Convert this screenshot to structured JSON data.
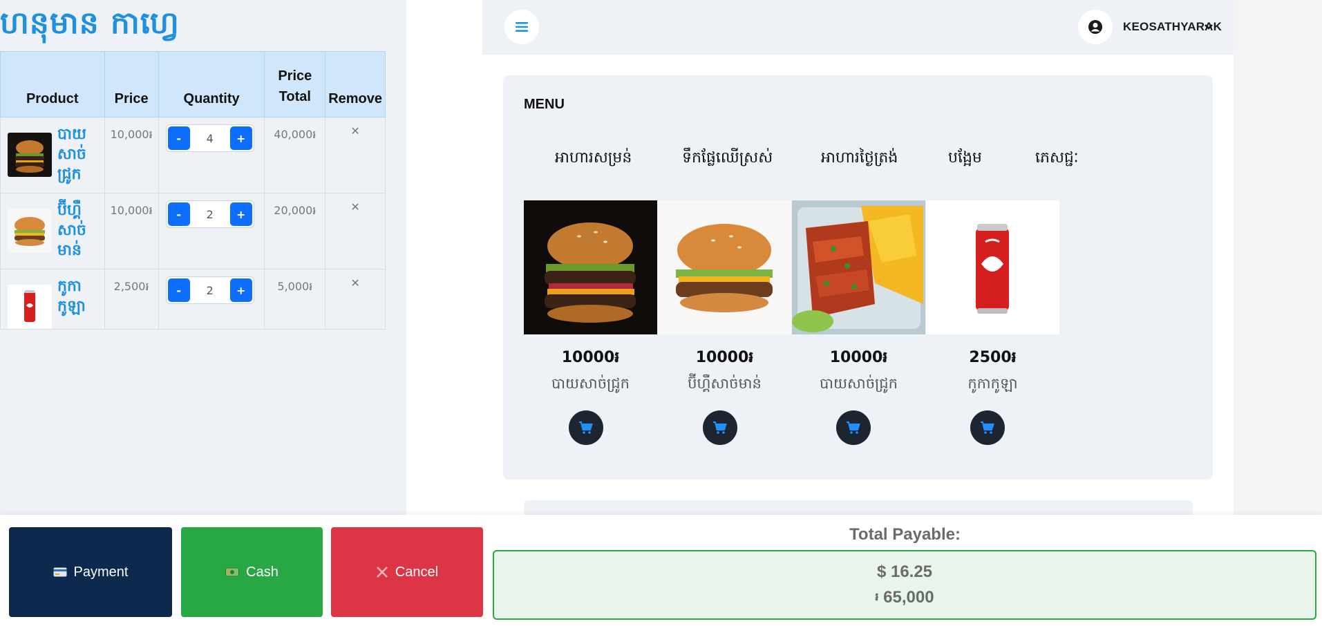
{
  "shop": {
    "title": "ហនុមាន កាហ្វេ"
  },
  "cart": {
    "headers": {
      "product": "Product",
      "price": "Price",
      "quantity": "Quantity",
      "price_total": "Price Total",
      "remove": "Remove"
    },
    "items": [
      {
        "name": "បាយសាច់ជ្រូក",
        "price": "10,000៛",
        "qty": "4",
        "total": "40,000៛",
        "thumb": "burger-dark"
      },
      {
        "name": "ប៊ីហ្គឺសាច់មាន់",
        "price": "10,000៛",
        "qty": "2",
        "total": "20,000៛",
        "thumb": "burger-light"
      },
      {
        "name": "កូកាកូឡា",
        "price": "2,500៛",
        "qty": "2",
        "total": "5,000៛",
        "thumb": "coca-cola-can"
      }
    ],
    "minus_label": "-",
    "plus_label": "+",
    "remove_glyph": "✕"
  },
  "header": {
    "menu_icon": "hamburger-icon",
    "user_icon": "user-circle-icon",
    "user_name": "KEOSATHYARAK",
    "dropdown_icon": "chevron-down-icon"
  },
  "menu": {
    "heading": "MENU",
    "categories": [
      "អាហារសម្រន់",
      "ទឹកផ្លែឈើស្រស់",
      "អាហារថ្ងៃត្រង់",
      "បង្អែម",
      "ភេសជ្ជៈ"
    ],
    "products": [
      {
        "price": "10000៛",
        "name": "បាយសាច់ជ្រូក",
        "image": "burger-dark"
      },
      {
        "price": "10000៛",
        "name": "ប៊ីហ្គឺសាច់មាន់",
        "image": "burger-light"
      },
      {
        "price": "10000៛",
        "name": "បាយសាច់ជ្រូក",
        "image": "grilled-pork-rice"
      },
      {
        "price": "2500៛",
        "name": "កូកាកូឡា",
        "image": "coca-cola-can"
      }
    ]
  },
  "actions": {
    "payment": "Payment",
    "cash": "Cash",
    "cancel": "Cancel"
  },
  "totals": {
    "label": "Total Payable:",
    "usd": "$ 16.25",
    "khr_symbol": "៛",
    "khr": "65,000"
  },
  "colors": {
    "accent": "#1f8fe0",
    "payment": "#0d2a4e",
    "cash": "#28a745",
    "cancel": "#dc3545",
    "total_border": "#2aa745",
    "plus_minus": "#0d6efd",
    "remove": "#e30d0d"
  }
}
